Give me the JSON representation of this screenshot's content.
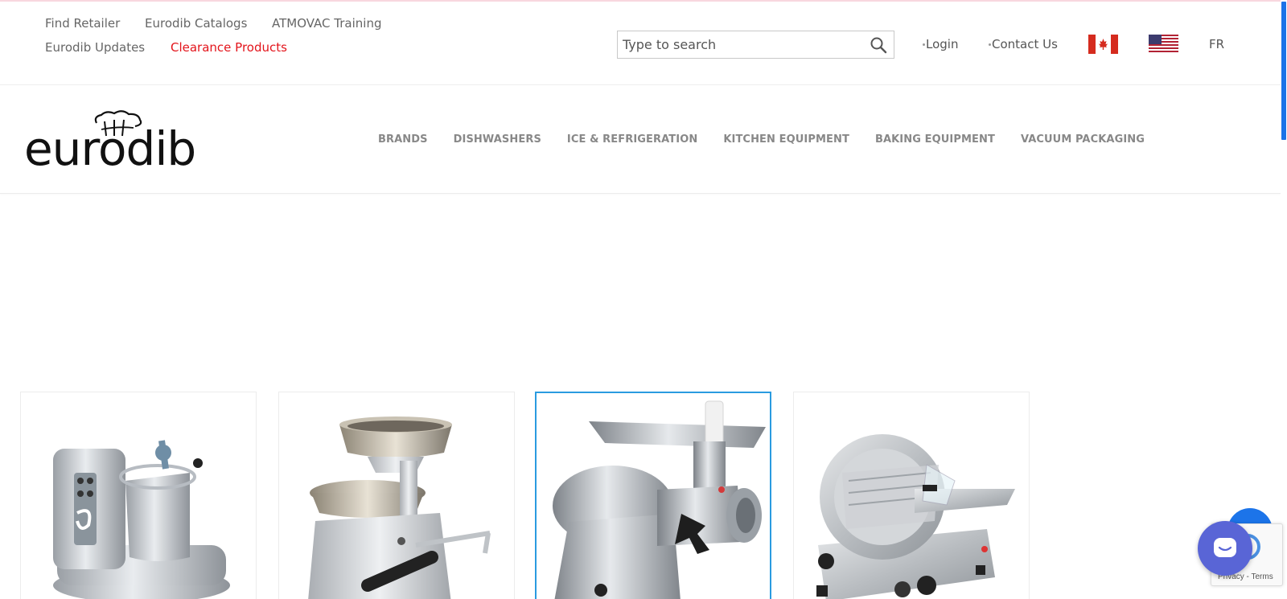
{
  "utility": {
    "links": [
      {
        "label": "Find Retailer"
      },
      {
        "label": "Eurodib Catalogs"
      },
      {
        "label": "ATMOVAC Training"
      },
      {
        "label": "Eurodib Updates"
      },
      {
        "label": "Clearance Products"
      }
    ],
    "search_placeholder": "Type to search",
    "login_label": "Login",
    "contact_label": "Contact Us",
    "lang_label": "FR"
  },
  "brand": {
    "logo_text": "eurodib"
  },
  "nav": {
    "items": [
      {
        "label": "BRANDS"
      },
      {
        "label": "DISHWASHERS"
      },
      {
        "label": "ICE & REFRIGERATION"
      },
      {
        "label": "KITCHEN EQUIPMENT"
      },
      {
        "label": "BAKING EQUIPMENT"
      },
      {
        "label": "VACUUM PACKAGING"
      }
    ]
  },
  "recaptcha": {
    "text": "Privacy - Terms"
  },
  "colors": {
    "accent_red": "#e3141b",
    "selected_border": "#2a9be0",
    "scroll_thumb": "#1a73e8",
    "chat_button": "#5965d6"
  },
  "icons": {
    "search": "magnifier-icon",
    "chat": "chat-bubble-icon",
    "scroll_top": "arrow-up-icon"
  }
}
